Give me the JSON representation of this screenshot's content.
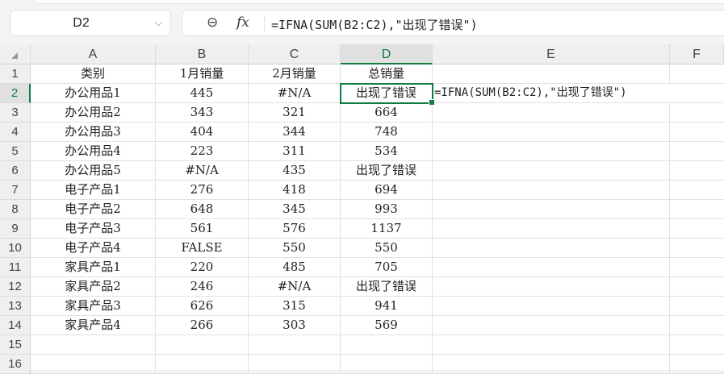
{
  "name_box": "D2",
  "formula": "=IFNA(SUM(B2:C2),\"出现了错误\")",
  "columns": [
    "A",
    "B",
    "C",
    "D",
    "E",
    "F"
  ],
  "rows": [
    [
      "类别",
      "1月销量",
      "2月销量",
      "总销量"
    ],
    [
      "办公用品1",
      "445",
      "#N/A",
      "出现了错误"
    ],
    [
      "办公用品2",
      "343",
      "321",
      "664"
    ],
    [
      "办公用品3",
      "404",
      "344",
      "748"
    ],
    [
      "办公用品4",
      "223",
      "311",
      "534"
    ],
    [
      "办公用品5",
      "#N/A",
      "435",
      "出现了错误"
    ],
    [
      "电子产品1",
      "276",
      "418",
      "694"
    ],
    [
      "电子产品2",
      "648",
      "345",
      "993"
    ],
    [
      "电子产品3",
      "561",
      "576",
      "1137"
    ],
    [
      "电子产品4",
      "FALSE",
      "550",
      "550"
    ],
    [
      "家具产品1",
      "220",
      "485",
      "705"
    ],
    [
      "家具产品2",
      "246",
      "#N/A",
      "出现了错误"
    ],
    [
      "家具产品3",
      "626",
      "315",
      "941"
    ],
    [
      "家具产品4",
      "266",
      "303",
      "569"
    ],
    [
      "",
      "",
      "",
      ""
    ],
    [
      "",
      "",
      "",
      ""
    ]
  ],
  "e2_text": "=IFNA(SUM(B2:C2),\"出现了错误\")",
  "accent": "#107c41"
}
